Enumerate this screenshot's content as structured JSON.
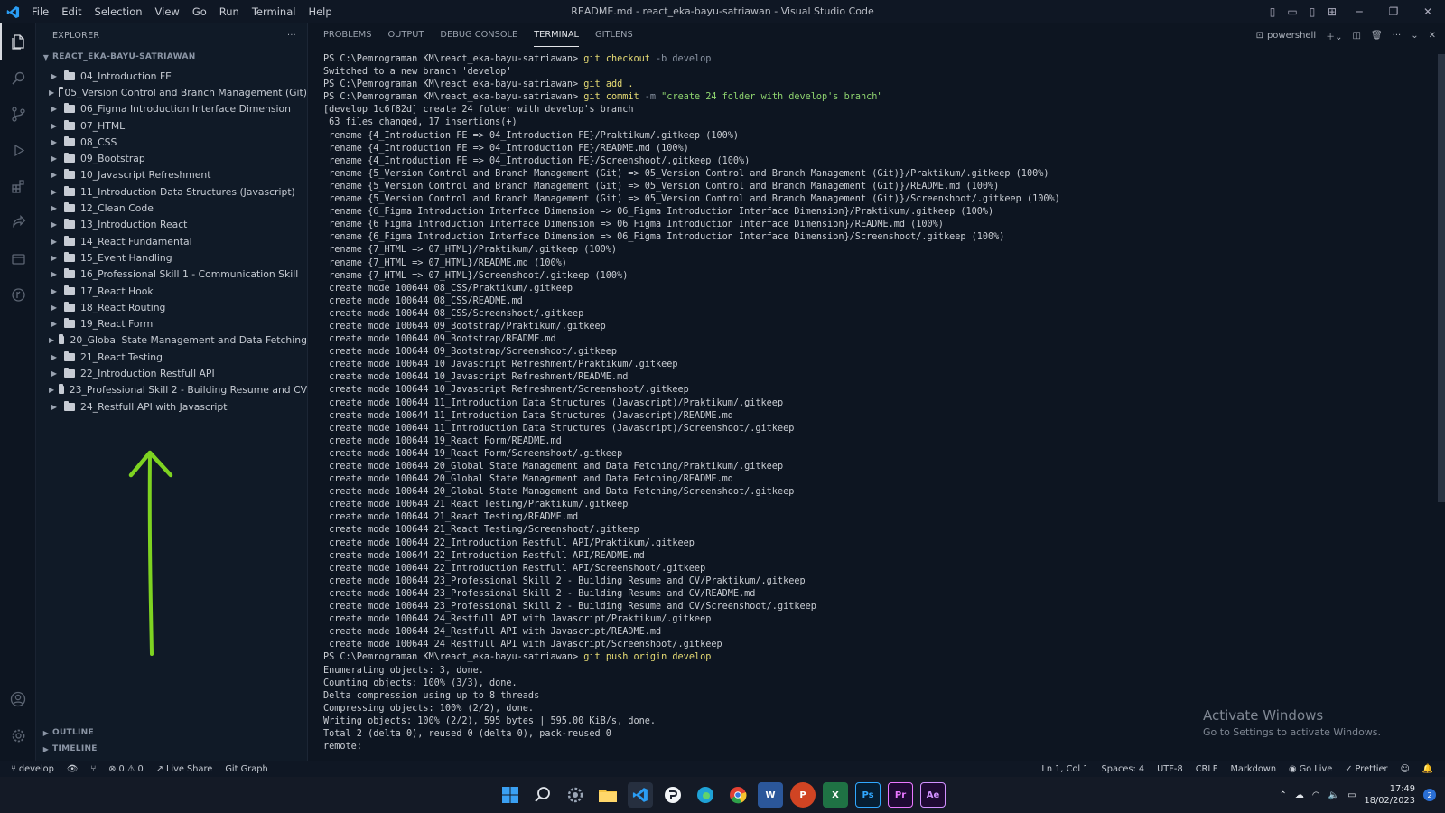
{
  "window": {
    "title": "README.md - react_eka-bayu-satriawan - Visual Studio Code",
    "menu": [
      "File",
      "Edit",
      "Selection",
      "View",
      "Go",
      "Run",
      "Terminal",
      "Help"
    ]
  },
  "explorer": {
    "header": "EXPLORER",
    "more": "···",
    "root": "REACT_EKA-BAYU-SATRIAWAN",
    "folders": [
      "04_Introduction FE",
      "05_Version Control and Branch Management (Git)",
      "06_Figma Introduction Interface Dimension",
      "07_HTML",
      "08_CSS",
      "09_Bootstrap",
      "10_Javascript Refreshment",
      "11_Introduction Data Structures (Javascript)",
      "12_Clean Code",
      "13_Introduction React",
      "14_React Fundamental",
      "15_Event Handling",
      "16_Professional Skill 1 - Communication Skill",
      "17_React Hook",
      "18_React Routing",
      "19_React Form",
      "20_Global State Management and Data Fetching",
      "21_React Testing",
      "22_Introduction Restfull API",
      "23_Professional Skill 2 - Building Resume and CV",
      "24_Restfull API with Javascript"
    ],
    "outline": "OUTLINE",
    "timeline": "TIMELINE"
  },
  "panel": {
    "tabs": [
      "PROBLEMS",
      "OUTPUT",
      "DEBUG CONSOLE",
      "TERMINAL",
      "GITLENS"
    ],
    "active_tab": "TERMINAL",
    "shell": "powershell",
    "prompt": "PS C:\\Pemrograman KM\\react_eka-bayu-satriawan>",
    "commands": {
      "checkout": "git checkout",
      "checkout_args": "-b develop",
      "add": "git add .",
      "commit": "git commit",
      "commit_flag": "-m",
      "commit_msg": "\"create 24 folder with develop's branch\"",
      "push": "git push origin develop"
    },
    "output_checkout": [
      "Switched to a new branch 'develop'"
    ],
    "output_commit": [
      "[develop 1c6f82d] create 24 folder with develop's branch",
      " 63 files changed, 17 insertions(+)",
      " rename {4_Introduction FE => 04_Introduction FE}/Praktikum/.gitkeep (100%)",
      " rename {4_Introduction FE => 04_Introduction FE}/README.md (100%)",
      " rename {4_Introduction FE => 04_Introduction FE}/Screenshoot/.gitkeep (100%)",
      " rename {5_Version Control and Branch Management (Git) => 05_Version Control and Branch Management (Git)}/Praktikum/.gitkeep (100%)",
      " rename {5_Version Control and Branch Management (Git) => 05_Version Control and Branch Management (Git)}/README.md (100%)",
      " rename {5_Version Control and Branch Management (Git) => 05_Version Control and Branch Management (Git)}/Screenshoot/.gitkeep (100%)",
      " rename {6_Figma Introduction Interface Dimension => 06_Figma Introduction Interface Dimension}/Praktikum/.gitkeep (100%)",
      " rename {6_Figma Introduction Interface Dimension => 06_Figma Introduction Interface Dimension}/README.md (100%)",
      " rename {6_Figma Introduction Interface Dimension => 06_Figma Introduction Interface Dimension}/Screenshoot/.gitkeep (100%)",
      " rename {7_HTML => 07_HTML}/Praktikum/.gitkeep (100%)",
      " rename {7_HTML => 07_HTML}/README.md (100%)",
      " rename {7_HTML => 07_HTML}/Screenshoot/.gitkeep (100%)",
      " create mode 100644 08_CSS/Praktikum/.gitkeep",
      " create mode 100644 08_CSS/README.md",
      " create mode 100644 08_CSS/Screenshoot/.gitkeep",
      " create mode 100644 09_Bootstrap/Praktikum/.gitkeep",
      " create mode 100644 09_Bootstrap/README.md",
      " create mode 100644 09_Bootstrap/Screenshoot/.gitkeep",
      " create mode 100644 10_Javascript Refreshment/Praktikum/.gitkeep",
      " create mode 100644 10_Javascript Refreshment/README.md",
      " create mode 100644 10_Javascript Refreshment/Screenshoot/.gitkeep",
      " create mode 100644 11_Introduction Data Structures (Javascript)/Praktikum/.gitkeep",
      " create mode 100644 11_Introduction Data Structures (Javascript)/README.md",
      " create mode 100644 11_Introduction Data Structures (Javascript)/Screenshoot/.gitkeep",
      " create mode 100644 19_React Form/README.md",
      " create mode 100644 19_React Form/Screenshoot/.gitkeep",
      " create mode 100644 20_Global State Management and Data Fetching/Praktikum/.gitkeep",
      " create mode 100644 20_Global State Management and Data Fetching/README.md",
      " create mode 100644 20_Global State Management and Data Fetching/Screenshoot/.gitkeep",
      " create mode 100644 21_React Testing/Praktikum/.gitkeep",
      " create mode 100644 21_React Testing/README.md",
      " create mode 100644 21_React Testing/Screenshoot/.gitkeep",
      " create mode 100644 22_Introduction Restfull API/Praktikum/.gitkeep",
      " create mode 100644 22_Introduction Restfull API/README.md",
      " create mode 100644 22_Introduction Restfull API/Screenshoot/.gitkeep",
      " create mode 100644 23_Professional Skill 2 - Building Resume and CV/Praktikum/.gitkeep",
      " create mode 100644 23_Professional Skill 2 - Building Resume and CV/README.md",
      " create mode 100644 23_Professional Skill 2 - Building Resume and CV/Screenshoot/.gitkeep",
      " create mode 100644 24_Restfull API with Javascript/Praktikum/.gitkeep",
      " create mode 100644 24_Restfull API with Javascript/README.md",
      " create mode 100644 24_Restfull API with Javascript/Screenshoot/.gitkeep"
    ],
    "output_push": [
      "Enumerating objects: 3, done.",
      "Counting objects: 100% (3/3), done.",
      "Delta compression using up to 8 threads",
      "Compressing objects: 100% (2/2), done.",
      "Writing objects: 100% (2/2), 595 bytes | 595.00 KiB/s, done.",
      "Total 2 (delta 0), reused 0 (delta 0), pack-reused 0",
      "remote:"
    ]
  },
  "watermark": {
    "line1": "Activate Windows",
    "line2": "Go to Settings to activate Windows."
  },
  "statusbar": {
    "branch": "develop",
    "errors": "0",
    "warnings": "0",
    "live_share": "Live Share",
    "git_graph": "Git Graph",
    "position": "Ln 1, Col 1",
    "spaces": "Spaces: 4",
    "encoding": "UTF-8",
    "eol": "CRLF",
    "language": "Markdown",
    "go_live": "Go Live",
    "prettier": "Prettier"
  },
  "taskbar": {
    "apps": [
      "W",
      "P",
      "X",
      "Ps",
      "Pr",
      "Ae"
    ],
    "time": "17:49",
    "date": "18/02/2023",
    "notifications": "2"
  },
  "colors": {
    "accent_blue": "#2a9df4",
    "arrow_green": "#7ed321",
    "command_yellow": "#e6db74",
    "string_green": "#8fd46f"
  }
}
